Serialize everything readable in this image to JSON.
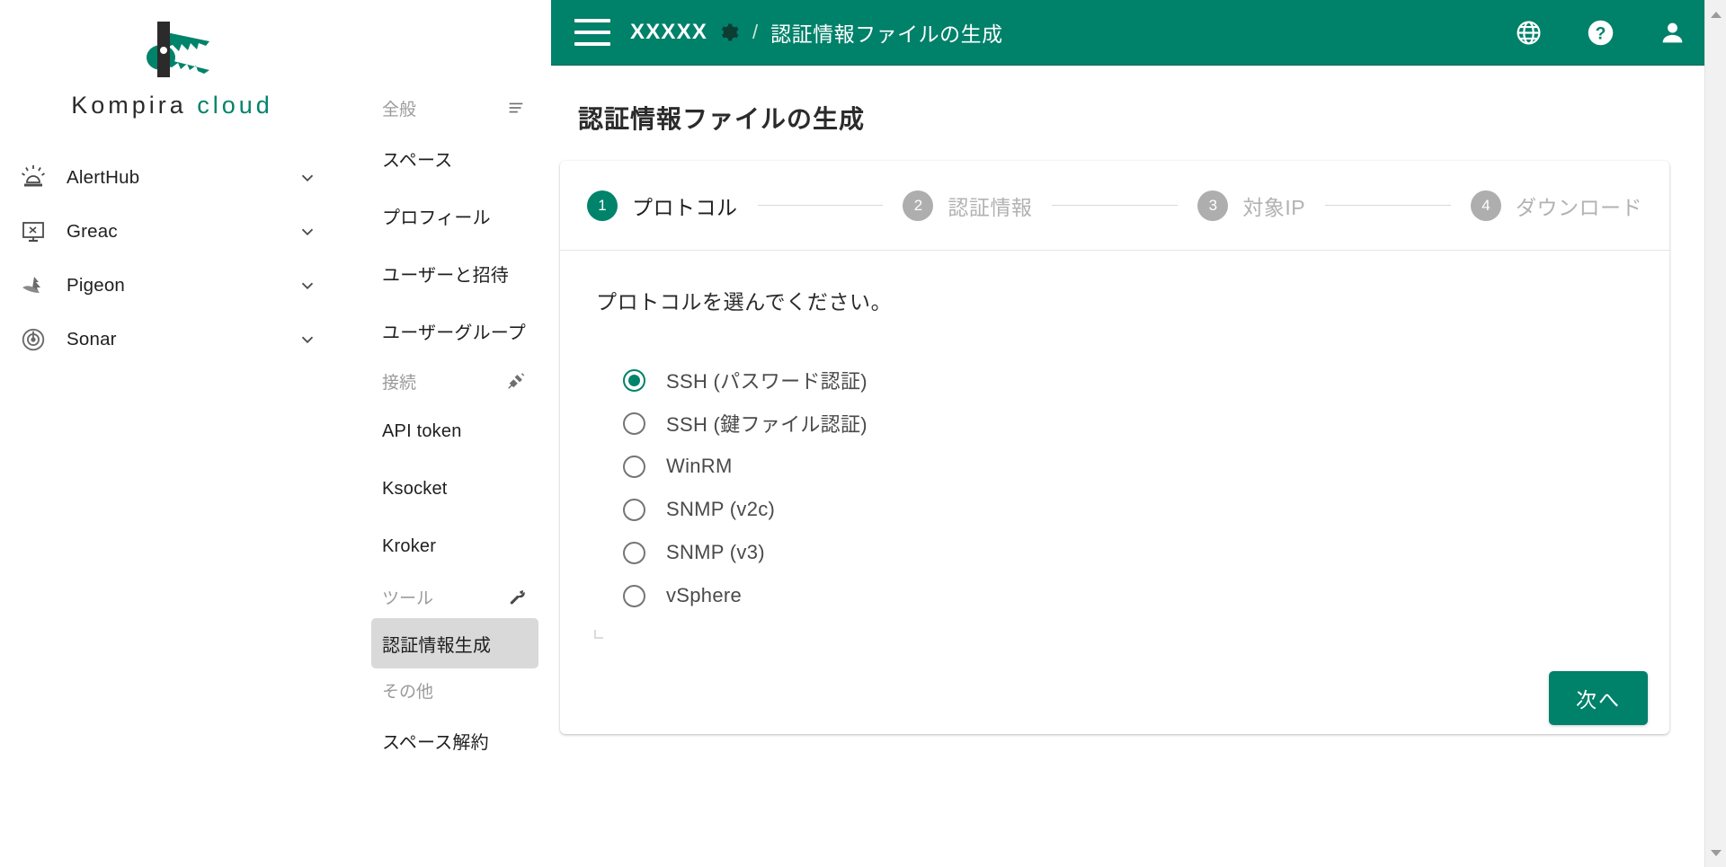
{
  "brand": {
    "logo_text_dark": "Kompira",
    "logo_text_accent": "cloud",
    "accent_color": "#00836b",
    "header_color": "#00816a"
  },
  "product_nav": {
    "items": [
      {
        "label": "AlertHub",
        "icon": "siren-icon",
        "chevron": "chevron-down-icon"
      },
      {
        "label": "Greac",
        "icon": "monitor-icon",
        "chevron": "chevron-down-icon"
      },
      {
        "label": "Pigeon",
        "icon": "pigeon-icon",
        "chevron": "chevron-down-icon"
      },
      {
        "label": "Sonar",
        "icon": "sonar-icon",
        "chevron": "chevron-down-icon"
      }
    ]
  },
  "sub_nav": {
    "sections": [
      {
        "title": "全般",
        "icon": "list-icon",
        "items": [
          {
            "label": "スペース",
            "active": false
          },
          {
            "label": "プロフィール",
            "active": false
          },
          {
            "label": "ユーザーと招待",
            "active": false
          },
          {
            "label": "ユーザーグループ",
            "active": false
          }
        ]
      },
      {
        "title": "接続",
        "icon": "plug-icon",
        "items": [
          {
            "label": "API token",
            "active": false
          },
          {
            "label": "Ksocket",
            "active": false
          },
          {
            "label": "Kroker",
            "active": false
          }
        ]
      },
      {
        "title": "ツール",
        "icon": "wrench-icon",
        "items": [
          {
            "label": "認証情報生成",
            "active": true
          }
        ]
      },
      {
        "title": "その他",
        "icon": "",
        "items": [
          {
            "label": "スペース解約",
            "active": false
          }
        ]
      }
    ]
  },
  "topbar": {
    "menu_icon": "hamburger-icon",
    "space_name": "XXXXX",
    "gear_icon": "gear-icon",
    "separator": "/",
    "breadcrumb_title": "認証情報ファイルの生成",
    "right_icons": [
      {
        "name": "globe-icon"
      },
      {
        "name": "help-icon"
      },
      {
        "name": "account-icon"
      }
    ]
  },
  "page": {
    "title": "認証情報ファイルの生成"
  },
  "stepper": {
    "steps": [
      {
        "number": "1",
        "label": "プロトコル",
        "state": "active"
      },
      {
        "number": "2",
        "label": "認証情報",
        "state": "todo"
      },
      {
        "number": "3",
        "label": "対象IP",
        "state": "todo"
      },
      {
        "number": "4",
        "label": "ダウンロード",
        "state": "todo"
      }
    ]
  },
  "form": {
    "prompt": "プロトコルを選んでください。",
    "options": [
      {
        "label": "SSH (パスワード認証)",
        "selected": true
      },
      {
        "label": "SSH (鍵ファイル認証)",
        "selected": false
      },
      {
        "label": "WinRM",
        "selected": false
      },
      {
        "label": "SNMP (v2c)",
        "selected": false
      },
      {
        "label": "SNMP (v3)",
        "selected": false
      },
      {
        "label": "vSphere",
        "selected": false
      }
    ],
    "next_label": "次へ"
  }
}
